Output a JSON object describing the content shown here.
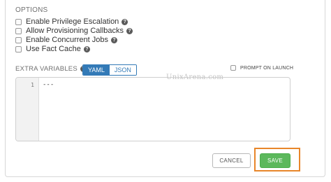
{
  "options": {
    "title": "OPTIONS",
    "items": [
      {
        "label": "Enable Privilege Escalation",
        "checked": false,
        "help_icon": "question-circle-icon"
      },
      {
        "label": "Allow Provisioning Callbacks",
        "checked": false,
        "help_icon": "question-circle-icon"
      },
      {
        "label": "Enable Concurrent Jobs",
        "checked": false,
        "help_icon": "question-circle-icon"
      },
      {
        "label": "Use Fact Cache",
        "checked": false,
        "help_icon": "question-circle-icon"
      }
    ]
  },
  "extra_variables": {
    "label": "EXTRA VARIABLES",
    "help_icon": "question-circle-icon",
    "format_options": [
      "YAML",
      "JSON"
    ],
    "selected_format": "YAML",
    "prompt_on_launch_label": "PROMPT ON LAUNCH",
    "prompt_on_launch_checked": false,
    "editor": {
      "line_numbers": [
        "1"
      ],
      "lines": [
        "---"
      ]
    }
  },
  "watermark": "UnixArena.com",
  "actions": {
    "cancel_label": "CANCEL",
    "save_label": "SAVE"
  },
  "colors": {
    "primary": "#337ab7",
    "success": "#5cb85c",
    "highlight": "#e8862a"
  }
}
